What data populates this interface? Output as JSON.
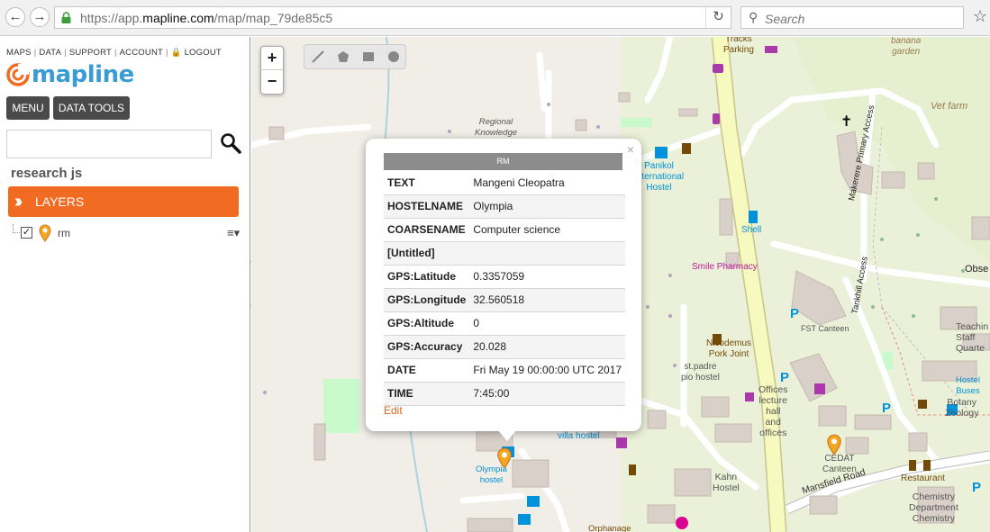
{
  "browser": {
    "url_prefix": "https://app.",
    "url_domain": "mapline.com",
    "url_path": "/map/map_79de85c5",
    "search_placeholder": "Search"
  },
  "sidebar": {
    "links": [
      "MAPS",
      "DATA",
      "SUPPORT",
      "ACCOUNT",
      "LOGOUT"
    ],
    "logo_text": "mapline",
    "menu_label": "MENU",
    "data_tools_label": "DATA TOOLS",
    "project_name": "research js",
    "layers_label": "LAYERS",
    "layer_name": "rm"
  },
  "map": {
    "labels": {
      "tracks_parking": "Tracks\nParking",
      "banana_garden": "banana\ngarden",
      "vet_farm": "Vet farm",
      "regional_knowledge": "Regional\nKnowledge",
      "panikol_hostel": "Panikol\nInternational\nHostel",
      "makerere_access": "Makerere Primary Access",
      "shell": "Shell",
      "smile_pharmacy": "Smile Pharmacy",
      "observatory": "Obse",
      "tankhill_access": "Tankhill Access",
      "fst_canteen": "FST Canteen",
      "teaching_staff": "Teachin\nStaff\nQuarte",
      "nicodemus_pork": "Nicodemus\nPork Joint",
      "st_padre": "st.padre\npio hostel",
      "offices_lecture": "Offices\nlecture\nhall\nand\noffices",
      "hostel_buses": "Hostel\nBuses",
      "botany": "Botany\nZoology",
      "villa_hostel": "villa hostel",
      "cedat_canteen": "CEDAT\nCanteen",
      "restaurant": "Restaurant",
      "kahn_hostel": "Kahn\nHostel",
      "mansfield_road": "Mansfield Road",
      "chemistry": "Chemistry\nDepartment\nChemistry",
      "olympia_hostel": "Olympia\nhostel",
      "orphanage": "Orphanage"
    }
  },
  "popup": {
    "title": "RM",
    "rows": [
      {
        "key": "TEXT",
        "value": "Mangeni Cleopatra"
      },
      {
        "key": "HOSTELNAME",
        "value": "Olympia"
      },
      {
        "key": "COARSENAME",
        "value": "Computer science"
      },
      {
        "key": "[Untitled]",
        "value": ""
      },
      {
        "key": "GPS:Latitude",
        "value": "0.3357059"
      },
      {
        "key": "GPS:Longitude",
        "value": "32.560518"
      },
      {
        "key": "GPS:Altitude",
        "value": "0"
      },
      {
        "key": "GPS:Accuracy",
        "value": "20.028"
      },
      {
        "key": "DATE",
        "value": "Fri May 19 00:00:00 UTC 2017"
      },
      {
        "key": "TIME",
        "value": "7:45:00"
      }
    ],
    "edit_label": "Edit",
    "close_glyph": "×"
  },
  "colors": {
    "accent_orange": "#f26b22",
    "logo_blue": "#3a9bd5",
    "map_background": "#f1eee8",
    "main_road": "#f7fabf",
    "building": "#d9d0c9",
    "park_green": "#c8facc"
  },
  "icons": [
    "back-icon",
    "forward-icon",
    "lock-icon",
    "reload-icon",
    "search-icon",
    "bookmark-star-icon",
    "logo-swirl-icon",
    "magnifier-icon",
    "map-pin-icon",
    "layer-menu-icon",
    "collapse-chevron-icon",
    "zoom-in-icon",
    "zoom-out-icon",
    "draw-line-icon",
    "draw-polygon-icon",
    "draw-rectangle-icon",
    "draw-circle-icon",
    "close-icon"
  ]
}
